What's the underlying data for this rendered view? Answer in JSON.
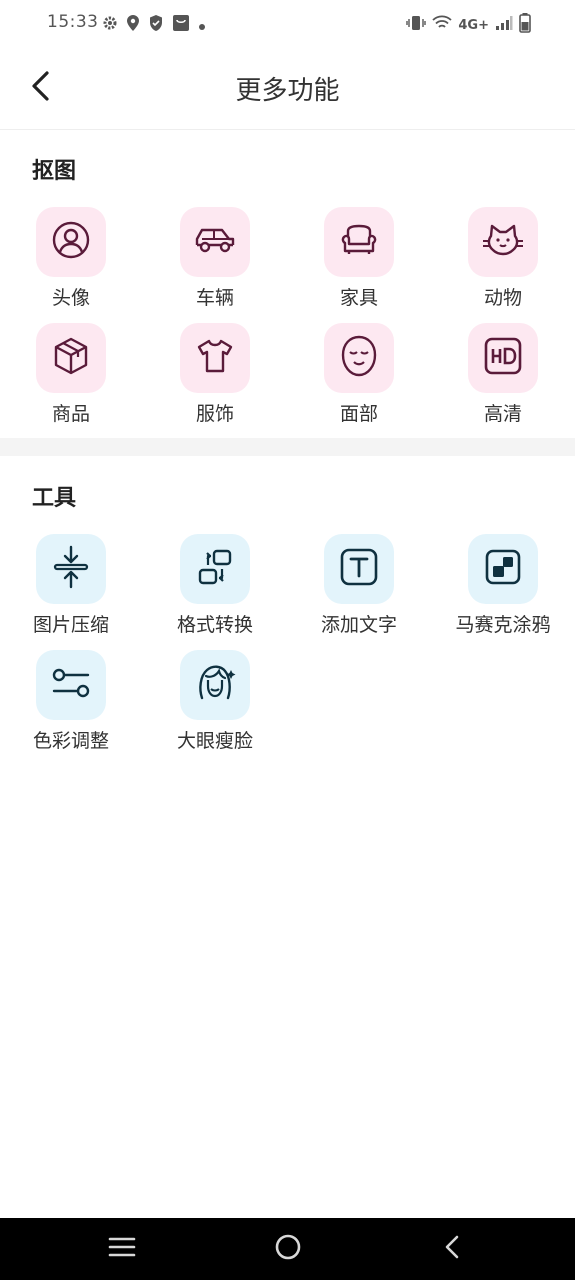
{
  "status_bar": {
    "time": "15:33",
    "left_icons": [
      "gear-icon",
      "location-icon",
      "shield-icon",
      "bag-icon",
      "dot-icon"
    ],
    "network": "4G+",
    "right_icons": [
      "vibrate-icon",
      "wifi-icon",
      "signal-icon",
      "battery-icon"
    ]
  },
  "app_bar": {
    "title": "更多功能",
    "back_icon": "chevron-left-icon"
  },
  "cutout_section": {
    "title": "抠图",
    "items": [
      {
        "label": "头像",
        "icon": "avatar-icon"
      },
      {
        "label": "车辆",
        "icon": "car-icon"
      },
      {
        "label": "家具",
        "icon": "sofa-icon"
      },
      {
        "label": "动物",
        "icon": "cat-icon"
      },
      {
        "label": "商品",
        "icon": "box-icon"
      },
      {
        "label": "服饰",
        "icon": "shirt-icon"
      },
      {
        "label": "面部",
        "icon": "face-icon"
      },
      {
        "label": "高清",
        "icon": "hd-icon"
      }
    ]
  },
  "tools_section": {
    "title": "工具",
    "items": [
      {
        "label": "图片压缩",
        "icon": "compress-icon"
      },
      {
        "label": "格式转换",
        "icon": "convert-icon"
      },
      {
        "label": "添加文字",
        "icon": "text-icon"
      },
      {
        "label": "马赛克涂鸦",
        "icon": "mosaic-icon"
      },
      {
        "label": "色彩调整",
        "icon": "sliders-icon"
      },
      {
        "label": "大眼瘦脸",
        "icon": "beauty-face-icon"
      }
    ]
  },
  "colors": {
    "pink_tile": "#fde8f1",
    "blue_tile": "#e3f4fb",
    "icon_stroke": "#5a1b3a",
    "tool_icon_stroke": "#0f3140"
  },
  "nav_bar": {
    "icons": [
      "menu-icon",
      "home-circle-icon",
      "back-triangle-icon"
    ]
  }
}
